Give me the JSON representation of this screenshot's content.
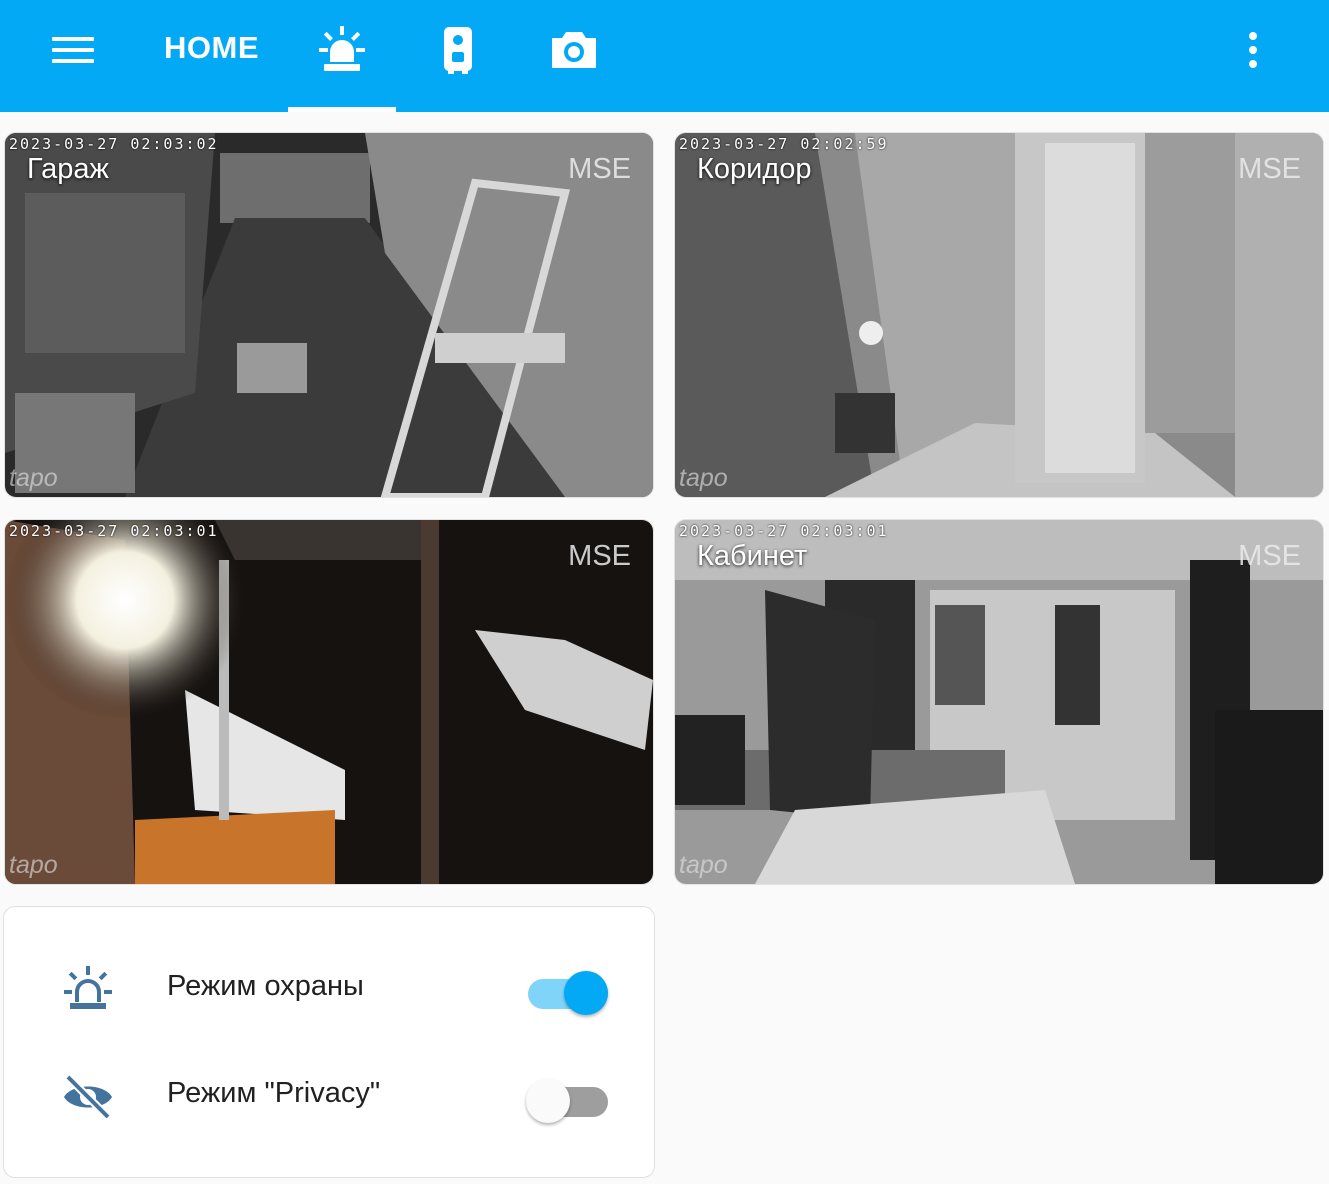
{
  "header": {
    "home_label": "HOME",
    "tabs": [
      {
        "icon": "alarm-light-icon"
      },
      {
        "icon": "doorbell-icon"
      },
      {
        "icon": "camera-icon"
      }
    ],
    "menu_icon": "hamburger-menu-icon",
    "overflow_icon": "dots-vertical-icon",
    "colors": {
      "bar": "#03a9f4",
      "active_indicator": "#ffffff"
    }
  },
  "cameras": [
    {
      "timestamp": "2023-03-27 02:03:02",
      "name": "Гараж",
      "stream_badge": "MSE",
      "brand": "tapo"
    },
    {
      "timestamp": "2023-03-27 02:02:59",
      "name": "Коридор",
      "stream_badge": "MSE",
      "brand": "tapo"
    },
    {
      "timestamp": "2023-03-27 02:03:01",
      "name": "",
      "stream_badge": "MSE",
      "brand": "tapo"
    },
    {
      "timestamp": "2023-03-27 02:03:01",
      "name": "Кабинет",
      "stream_badge": "MSE",
      "brand": "tapo"
    }
  ],
  "entities": [
    {
      "icon": "alarm-light-outline-icon",
      "label": "Режим охраны",
      "state": "on"
    },
    {
      "icon": "eye-off-icon",
      "label": "Режим \"Privacy\"",
      "state": "off"
    }
  ],
  "colors": {
    "accent": "#03a9f4",
    "icon": "#44739e",
    "toggle_on_track": "#80d4fa",
    "toggle_off_track": "#9e9e9e"
  }
}
